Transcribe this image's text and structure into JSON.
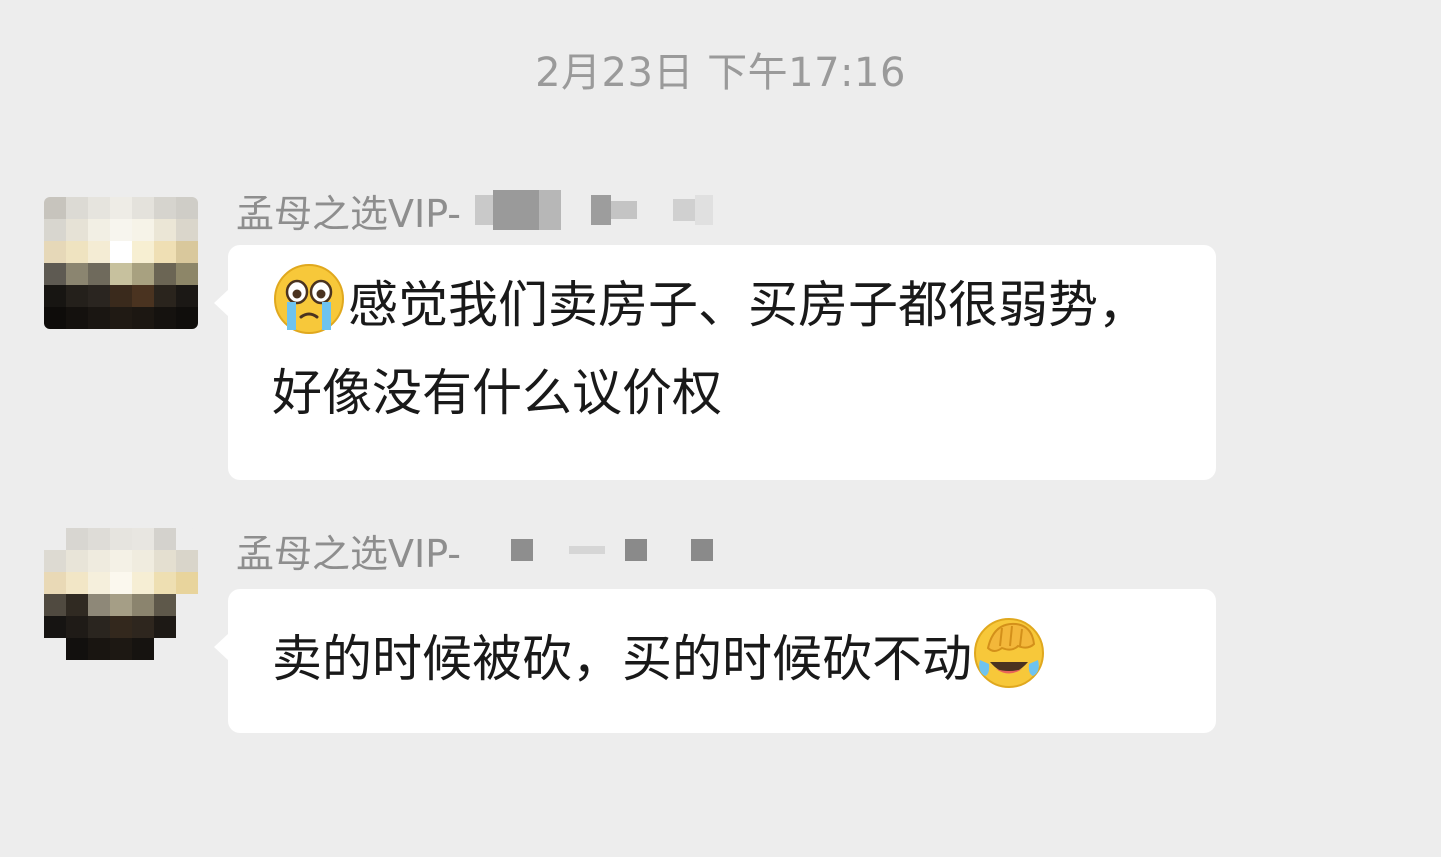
{
  "chat": {
    "timestamp": "2月23日 下午17:16",
    "messages": [
      {
        "sender": "孟母之选VIP-",
        "emoji": "crying-face-icon",
        "text": "感觉我们卖房子、买房子都很弱势，好像没有什么议价权"
      },
      {
        "sender": "孟母之选VIP-",
        "emoji": "facepalm-laughing-icon",
        "text": "卖的时候被砍，买的时候砍不动"
      }
    ]
  },
  "colors": {
    "background": "#ededed",
    "bubble": "#ffffff",
    "text": "#191919",
    "muted": "#8e8e8e",
    "timestamp": "#9a9a9a"
  }
}
